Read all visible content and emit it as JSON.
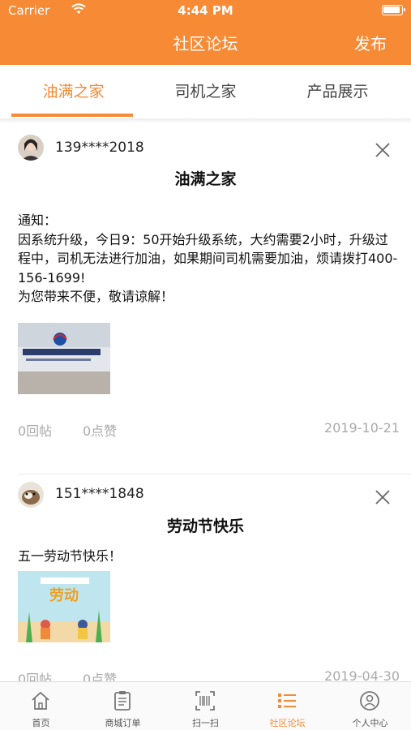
{
  "status_bar": {
    "carrier": "Carrier",
    "time": "4:44 PM"
  },
  "nav": {
    "title": "社区论坛",
    "publish_label": "发布"
  },
  "tabs": [
    {
      "label": "油满之家",
      "active": true
    },
    {
      "label": "司机之家",
      "active": false
    },
    {
      "label": "产品展示",
      "active": false
    }
  ],
  "posts": [
    {
      "user": "139****2018",
      "title": "油满之家",
      "body": "通知：\n因系统升级，今日9：50开始升级系统，大约需要2小时，升级过程中，司机无法进行加油，如果期间司机需要加油，烦请拨打400-156-1699!\n为您带来不便，敬请谅解！",
      "replies": "0回帖",
      "likes": "0点赞",
      "date": "2019-10-21"
    },
    {
      "user": "151****1848",
      "title": "劳动节快乐",
      "body": "五一劳动节快乐！",
      "replies": "0回帖",
      "likes": "0点赞",
      "date": "2019-04-30"
    }
  ],
  "bottom_nav": [
    {
      "label": "首页",
      "icon": "home-icon"
    },
    {
      "label": "商城订单",
      "icon": "order-icon"
    },
    {
      "label": "扫一扫",
      "icon": "scan-icon"
    },
    {
      "label": "社区论坛",
      "icon": "forum-icon",
      "active": true
    },
    {
      "label": "个人中心",
      "icon": "profile-icon"
    }
  ],
  "colors": {
    "accent": "#F68A35",
    "muted": "#aaaaaa"
  }
}
